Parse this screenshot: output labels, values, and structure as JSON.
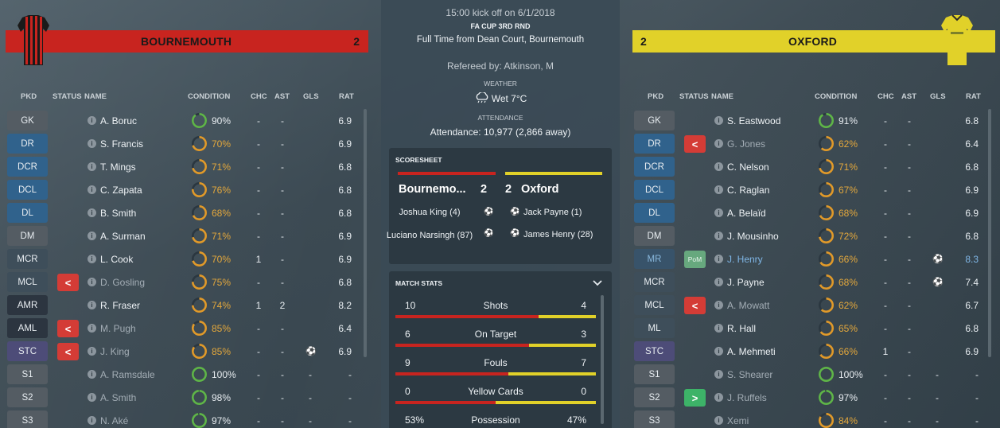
{
  "match": {
    "kickoff": "15:00 kick off on 6/1/2018",
    "competition": "FA CUP 3RD RND",
    "full_time_line": "Full Time from Dean Court, Bournemouth",
    "referee": "Refereed by: Atkinson, M",
    "weather_label": "WEATHER",
    "weather": "Wet 7°C",
    "attendance_label": "ATTENDANCE",
    "attendance": "Attendance: 10,977 (2,866 away)"
  },
  "columns": {
    "pkd": "PKD",
    "status": "STATUS",
    "name": "NAME",
    "condition": "CONDITION",
    "chc": "CHC",
    "ast": "AST",
    "gls": "GLS",
    "rat": "RAT"
  },
  "home": {
    "name": "BOURNEMOUTH",
    "score": "2",
    "colors": {
      "primary": "#c8241f",
      "secondary": "#1a1a1a"
    },
    "players": [
      {
        "pos": "GK",
        "pos_style": "gk",
        "name": "A. Boruc",
        "status": "",
        "cond": "90%",
        "cond_frac": 0.9,
        "chc": "-",
        "ast": "-",
        "gls": "",
        "goal_icon": false,
        "rat": "6.9"
      },
      {
        "pos": "DR",
        "pos_style": "def",
        "name": "S. Francis",
        "status": "",
        "cond": "70%",
        "cond_frac": 0.7,
        "chc": "-",
        "ast": "-",
        "gls": "",
        "goal_icon": false,
        "rat": "6.9"
      },
      {
        "pos": "DCR",
        "pos_style": "def",
        "name": "T. Mings",
        "status": "",
        "cond": "71%",
        "cond_frac": 0.71,
        "chc": "-",
        "ast": "-",
        "gls": "",
        "goal_icon": false,
        "rat": "6.8"
      },
      {
        "pos": "DCL",
        "pos_style": "def",
        "name": "C. Zapata",
        "status": "",
        "cond": "76%",
        "cond_frac": 0.76,
        "chc": "-",
        "ast": "-",
        "gls": "",
        "goal_icon": false,
        "rat": "6.8"
      },
      {
        "pos": "DL",
        "pos_style": "def",
        "name": "B. Smith",
        "status": "",
        "cond": "68%",
        "cond_frac": 0.68,
        "chc": "-",
        "ast": "-",
        "gls": "",
        "goal_icon": false,
        "rat": "6.8"
      },
      {
        "pos": "DM",
        "pos_style": "dm",
        "name": "A. Surman",
        "status": "",
        "cond": "71%",
        "cond_frac": 0.71,
        "chc": "-",
        "ast": "-",
        "gls": "",
        "goal_icon": false,
        "rat": "6.9"
      },
      {
        "pos": "MCR",
        "pos_style": "mid",
        "name": "L. Cook",
        "status": "",
        "cond": "70%",
        "cond_frac": 0.7,
        "chc": "1",
        "ast": "-",
        "gls": "",
        "goal_icon": false,
        "rat": "6.9"
      },
      {
        "pos": "MCL",
        "pos_style": "mid",
        "name": "D. Gosling",
        "status": "off",
        "cond": "75%",
        "cond_frac": 0.75,
        "chc": "-",
        "ast": "-",
        "gls": "",
        "goal_icon": false,
        "rat": "6.8"
      },
      {
        "pos": "AMR",
        "pos_style": "amr",
        "name": "R. Fraser",
        "status": "",
        "cond": "74%",
        "cond_frac": 0.74,
        "chc": "1",
        "ast": "2",
        "gls": "",
        "goal_icon": false,
        "rat": "8.2"
      },
      {
        "pos": "AML",
        "pos_style": "amr",
        "name": "M. Pugh",
        "status": "off",
        "cond": "85%",
        "cond_frac": 0.85,
        "chc": "-",
        "ast": "-",
        "gls": "",
        "goal_icon": false,
        "rat": "6.4"
      },
      {
        "pos": "STC",
        "pos_style": "stc",
        "name": "J. King",
        "status": "off",
        "cond": "85%",
        "cond_frac": 0.85,
        "chc": "-",
        "ast": "-",
        "gls": "",
        "goal_icon": true,
        "rat": "6.9"
      },
      {
        "pos": "S1",
        "pos_style": "sub",
        "name": "A. Ramsdale",
        "status": "",
        "cond": "100%",
        "cond_frac": 1.0,
        "chc": "-",
        "ast": "-",
        "gls": "-",
        "goal_icon": false,
        "rat": "-"
      },
      {
        "pos": "S2",
        "pos_style": "sub",
        "name": "A. Smith",
        "status": "",
        "cond": "98%",
        "cond_frac": 0.98,
        "chc": "-",
        "ast": "-",
        "gls": "-",
        "goal_icon": false,
        "rat": "-"
      },
      {
        "pos": "S3",
        "pos_style": "sub",
        "name": "N. Aké",
        "status": "",
        "cond": "97%",
        "cond_frac": 0.97,
        "chc": "-",
        "ast": "-",
        "gls": "-",
        "goal_icon": false,
        "rat": "-"
      }
    ]
  },
  "away": {
    "name": "OXFORD",
    "score": "2",
    "colors": {
      "primary": "#e1d129",
      "secondary": "#1a1a1a"
    },
    "players": [
      {
        "pos": "GK",
        "pos_style": "gk",
        "name": "S. Eastwood",
        "status": "",
        "cond": "91%",
        "cond_frac": 0.91,
        "chc": "-",
        "ast": "-",
        "gls": "",
        "goal_icon": false,
        "rat": "6.8"
      },
      {
        "pos": "DR",
        "pos_style": "def",
        "name": "G. Jones",
        "status": "off",
        "cond": "62%",
        "cond_frac": 0.62,
        "chc": "-",
        "ast": "-",
        "gls": "",
        "goal_icon": false,
        "rat": "6.4"
      },
      {
        "pos": "DCR",
        "pos_style": "def",
        "name": "C. Nelson",
        "status": "",
        "cond": "71%",
        "cond_frac": 0.71,
        "chc": "-",
        "ast": "-",
        "gls": "",
        "goal_icon": false,
        "rat": "6.8"
      },
      {
        "pos": "DCL",
        "pos_style": "def",
        "name": "C. Raglan",
        "status": "",
        "cond": "67%",
        "cond_frac": 0.67,
        "chc": "-",
        "ast": "-",
        "gls": "",
        "goal_icon": false,
        "rat": "6.9"
      },
      {
        "pos": "DL",
        "pos_style": "def",
        "name": "A. Belaïd",
        "status": "",
        "cond": "68%",
        "cond_frac": 0.68,
        "chc": "-",
        "ast": "-",
        "gls": "",
        "goal_icon": false,
        "rat": "6.9"
      },
      {
        "pos": "DM",
        "pos_style": "dm",
        "name": "J. Mousinho",
        "status": "",
        "cond": "72%",
        "cond_frac": 0.72,
        "chc": "-",
        "ast": "-",
        "gls": "",
        "goal_icon": false,
        "rat": "6.8"
      },
      {
        "pos": "MR",
        "pos_style": "mr",
        "name": "J. Henry",
        "status": "pom",
        "status_label": "PoM",
        "cond": "66%",
        "cond_frac": 0.66,
        "chc": "-",
        "ast": "-",
        "gls": "",
        "goal_icon": true,
        "rat": "8.3"
      },
      {
        "pos": "MCR",
        "pos_style": "mid",
        "name": "J. Payne",
        "status": "",
        "cond": "68%",
        "cond_frac": 0.68,
        "chc": "-",
        "ast": "-",
        "gls": "",
        "goal_icon": true,
        "rat": "7.4"
      },
      {
        "pos": "MCL",
        "pos_style": "mid",
        "name": "A. Mowatt",
        "status": "off",
        "cond": "62%",
        "cond_frac": 0.62,
        "chc": "-",
        "ast": "-",
        "gls": "",
        "goal_icon": false,
        "rat": "6.7"
      },
      {
        "pos": "ML",
        "pos_style": "mid",
        "name": "R. Hall",
        "status": "",
        "cond": "65%",
        "cond_frac": 0.65,
        "chc": "-",
        "ast": "-",
        "gls": "",
        "goal_icon": false,
        "rat": "6.8"
      },
      {
        "pos": "STC",
        "pos_style": "stc",
        "name": "A. Mehmeti",
        "status": "",
        "cond": "66%",
        "cond_frac": 0.66,
        "chc": "1",
        "ast": "-",
        "gls": "",
        "goal_icon": false,
        "rat": "6.9"
      },
      {
        "pos": "S1",
        "pos_style": "sub",
        "name": "S. Shearer",
        "status": "",
        "cond": "100%",
        "cond_frac": 1.0,
        "chc": "-",
        "ast": "-",
        "gls": "-",
        "goal_icon": false,
        "rat": "-"
      },
      {
        "pos": "S2",
        "pos_style": "sub",
        "name": "J. Ruffels",
        "status": "on",
        "cond": "97%",
        "cond_frac": 0.97,
        "chc": "-",
        "ast": "-",
        "gls": "-",
        "goal_icon": false,
        "rat": "-"
      },
      {
        "pos": "S3",
        "pos_style": "sub",
        "name": "Xemi",
        "status": "",
        "cond": "84%",
        "cond_frac": 0.84,
        "chc": "-",
        "ast": "-",
        "gls": "-",
        "goal_icon": false,
        "rat": "-"
      }
    ]
  },
  "scoresheet": {
    "heading": "SCORESHEET",
    "home_name": "Bournemo...",
    "home_score": "2",
    "away_score": "2",
    "away_name": "Oxford",
    "home_scorers": [
      "Joshua King (4)",
      "Luciano Narsingh (87)"
    ],
    "away_scorers": [
      "Jack Payne (1)",
      "James Henry (28)"
    ]
  },
  "match_stats": {
    "heading": "MATCH STATS",
    "rows": [
      {
        "label": "Shots",
        "home": "10",
        "away": "4",
        "home_share": 0.714
      },
      {
        "label": "On Target",
        "home": "6",
        "away": "3",
        "home_share": 0.667
      },
      {
        "label": "Fouls",
        "home": "9",
        "away": "7",
        "home_share": 0.5625
      },
      {
        "label": "Yellow Cards",
        "home": "0",
        "away": "0",
        "home_share": 0.5
      },
      {
        "label": "Possession",
        "home": "53%",
        "away": "47%",
        "home_share": 0.53
      }
    ]
  },
  "icons": {
    "goal": "⚽",
    "sub_off": "<",
    "sub_on": ">",
    "info": "i",
    "chevron": "⌄"
  },
  "condition_colors": {
    "high": "#5fb548",
    "mid": "#e19a2a",
    "track": "#2b3740"
  }
}
